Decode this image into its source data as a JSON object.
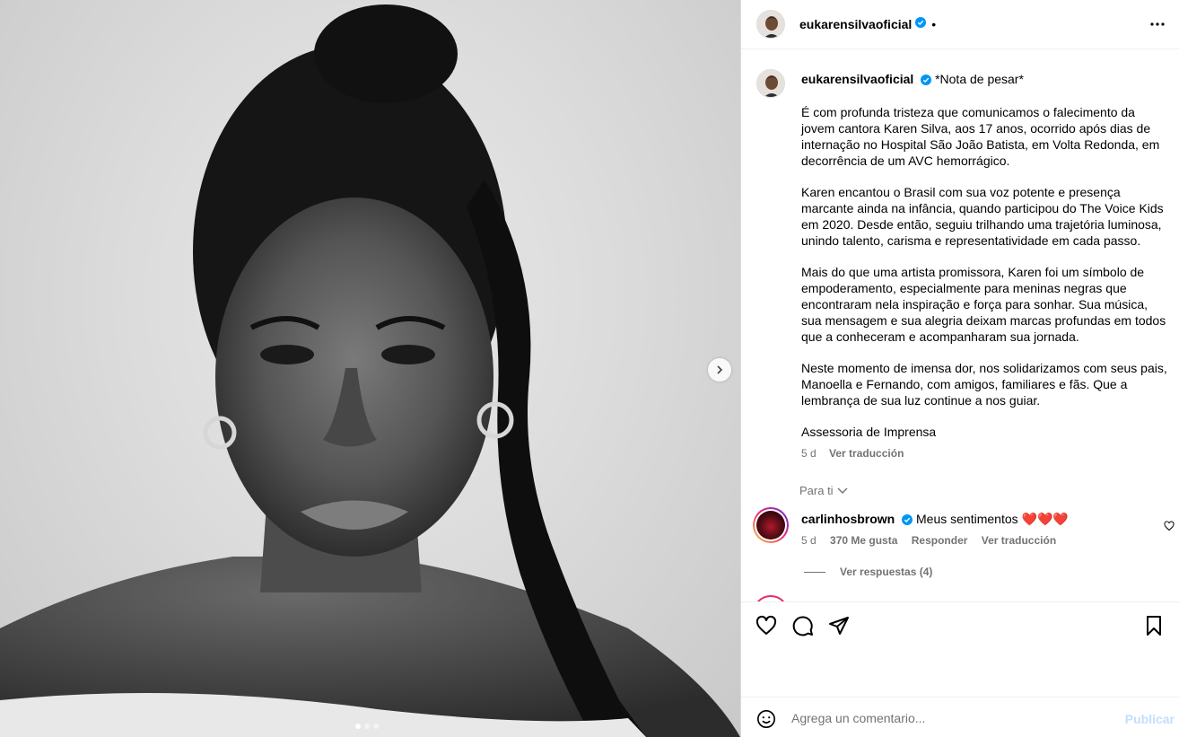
{
  "post": {
    "username": "eukarensilvaoficial",
    "separator": "•",
    "caption_title": "*Nota de pesar*",
    "paragraphs": [
      "É com profunda tristeza que comunicamos o falecimento da jovem cantora Karen Silva, aos 17 anos, ocorrido após dias de internação no Hospital São João Batista, em Volta Redonda, em decorrência de um AVC hemorrágico.",
      "Karen encantou o Brasil com sua voz potente e presença marcante ainda na infância, quando participou do The Voice Kids em 2020. Desde então, seguiu trilhando uma trajetória luminosa, unindo talento, carisma e representatividade em cada passo.",
      "Mais do que uma artista promissora, Karen foi um símbolo de empoderamento, especialmente para meninas negras que encontraram nela inspiração e força para sonhar. Sua música, sua mensagem e sua alegria deixam marcas profundas em todos que a conheceram e acompanharam sua jornada.",
      "Neste momento de imensa dor, nos solidarizamos com seus pais, Manoella e Fernando, com amigos, familiares e fãs. Que a lembrança de sua luz continue a nos guiar.",
      "Assessoria de Imprensa"
    ],
    "time": "5 d",
    "translate_label": "Ver traducción"
  },
  "media": {
    "slide_count": 3,
    "active_slide": 1,
    "photo_icon": "portrait-photo",
    "next_icon": "chevron-right-icon"
  },
  "comments": {
    "for_you_label": "Para ti",
    "items": [
      {
        "username": "carlinhosbrown",
        "text": "Meus sentimentos ",
        "emoji": "❤️❤️❤️",
        "time": "5 d",
        "likes": "370 Me gusta",
        "reply_label": "Responder",
        "translate_label": "Ver traducción",
        "view_replies": "Ver respuestas (4)"
      }
    ]
  },
  "composer": {
    "placeholder": "Agrega un comentario...",
    "publish_label": "Publicar"
  },
  "colors": {
    "verified": "#0095f6",
    "muted": "#737373",
    "publish_disabled": "#c0dffd"
  }
}
